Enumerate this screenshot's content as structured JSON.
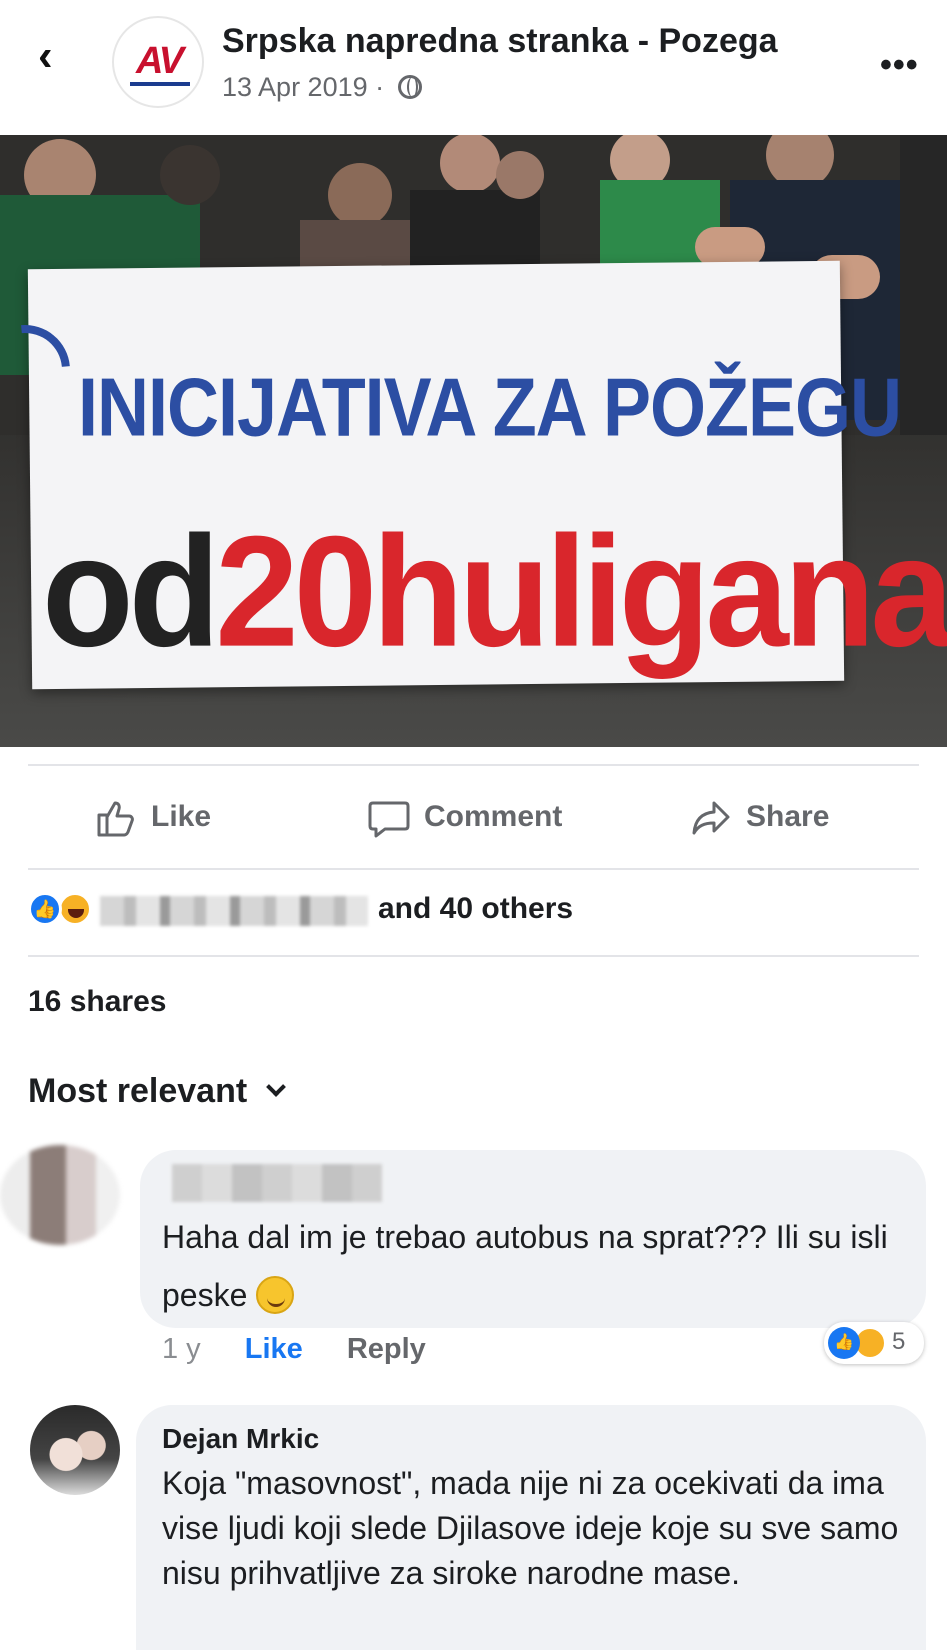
{
  "header": {
    "back_icon": "chevron-left-icon",
    "page_name": "Srpska napredna stranka - Pozega",
    "post_date": "13 Apr 2019 ·",
    "privacy_icon": "globe-icon",
    "more_label": "•••",
    "logo_text": "AV"
  },
  "photo": {
    "banner_line1": "INICIJATIVA ZA POŽEGU",
    "banner_line2_prefix": "od",
    "banner_line2_main": "20huligana",
    "colors": {
      "banner_blue": "#2c4ea3",
      "banner_red": "#d9262c"
    }
  },
  "actions": {
    "like_label": "Like",
    "comment_label": "Comment",
    "share_label": "Share"
  },
  "reactions": {
    "summary_suffix": "and 40 others",
    "icons": [
      "like-icon",
      "haha-icon"
    ]
  },
  "stats": {
    "shares": "16 shares"
  },
  "comments_sort": {
    "label": "Most relevant"
  },
  "comments": [
    {
      "text": "Haha dal im je trebao autobus na sprat??? Ili su isli peske",
      "age": "1 y",
      "like_label": "Like",
      "reply_label": "Reply",
      "reaction_count": "5"
    },
    {
      "author": "Dejan Mrkic",
      "text": "Koja \"masovnost\", mada nije ni za ocekivati da ima vise ljudi koji slede Djilasove ideje koje su sve samo nisu prihvatljive za siroke narodne mase."
    }
  ],
  "colors": {
    "link_blue": "#1877f2",
    "muted_gray": "#65676b",
    "bubble_bg": "#f0f2f5"
  }
}
